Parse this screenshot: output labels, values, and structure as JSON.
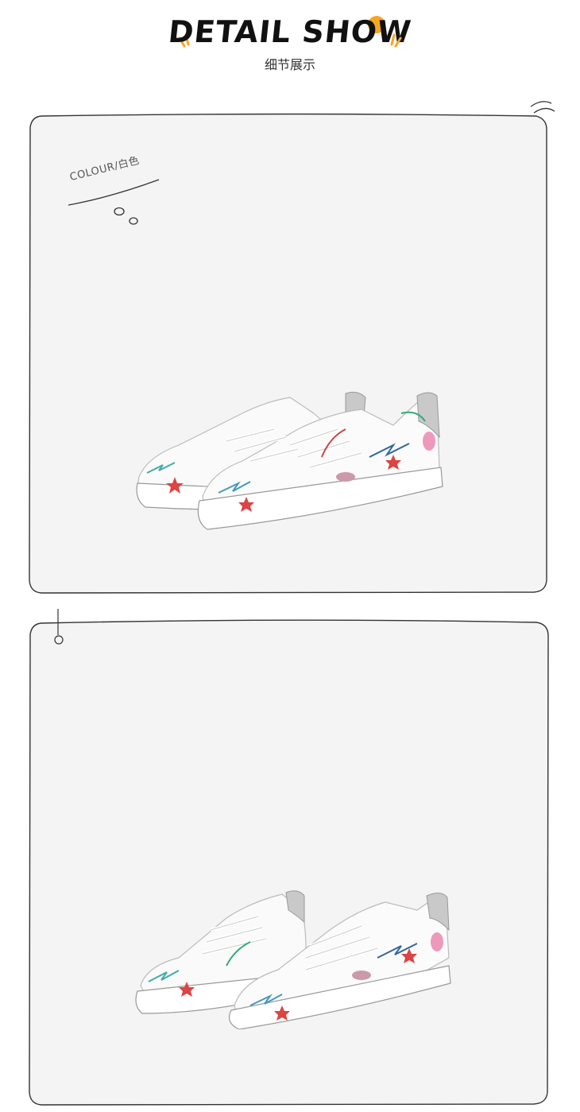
{
  "header": {
    "title": "DETAIL SHOW",
    "subtitle": "细节展示"
  },
  "panel1": {
    "colour_label": "COLOUR/白色",
    "image_desc": "sneaker-pair-side-view"
  },
  "panel2": {
    "image_desc": "sneaker-pair-front-view"
  },
  "colors": {
    "accent": "#f6a623",
    "panel_bg": "#f4f4f4",
    "outline": "#333333"
  }
}
